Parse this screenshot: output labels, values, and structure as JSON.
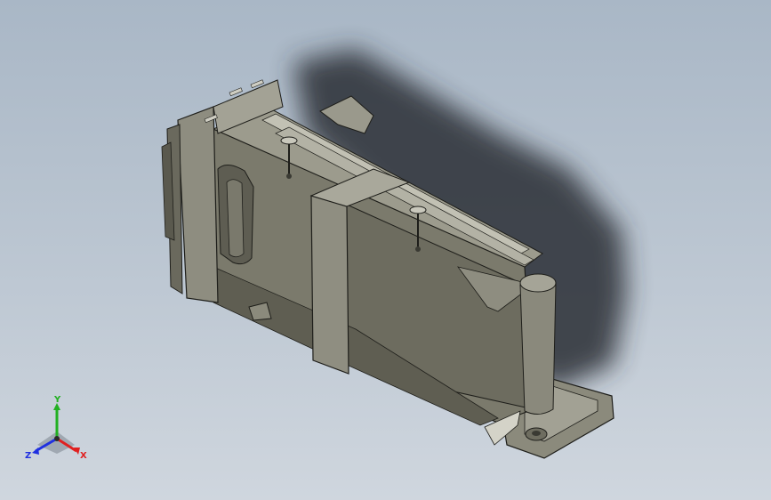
{
  "view": {
    "background_top": "#a9b7c6",
    "background_bottom": "#cfd6de"
  },
  "model": {
    "body_color": "#7b7a6c",
    "edge_color": "#1e1e1a",
    "shadow_color": "#2b2f35"
  },
  "triad": {
    "x_label": "X",
    "y_label": "Y",
    "z_label": "Z",
    "x_color": "#e02020",
    "y_color": "#22b022",
    "z_color": "#2030e0"
  }
}
